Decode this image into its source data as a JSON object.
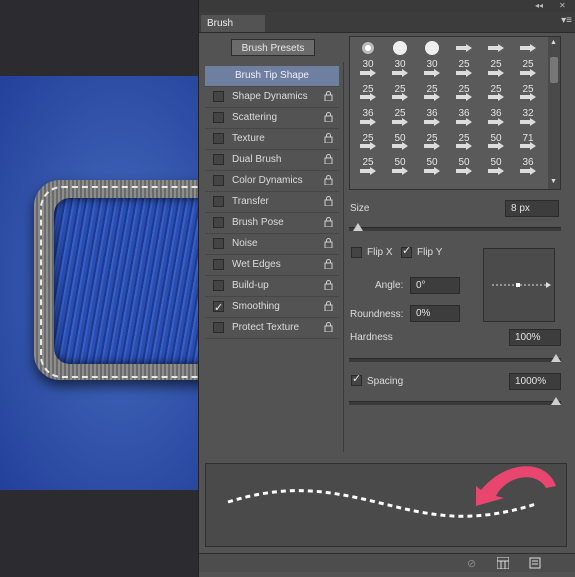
{
  "panel": {
    "tab_label": "Brush",
    "menu_icon": "panel-menu-icon",
    "collapse_icon": "double-chevron-icon",
    "close_icon": "close-icon"
  },
  "presets_button": "Brush Presets",
  "settings": [
    {
      "label": "Brush Tip Shape",
      "checkbox": false,
      "checked": false,
      "lock": false,
      "selected": true
    },
    {
      "label": "Shape Dynamics",
      "checkbox": true,
      "checked": false,
      "lock": true,
      "selected": false
    },
    {
      "label": "Scattering",
      "checkbox": true,
      "checked": false,
      "lock": true,
      "selected": false
    },
    {
      "label": "Texture",
      "checkbox": true,
      "checked": false,
      "lock": true,
      "selected": false
    },
    {
      "label": "Dual Brush",
      "checkbox": true,
      "checked": false,
      "lock": true,
      "selected": false
    },
    {
      "label": "Color Dynamics",
      "checkbox": true,
      "checked": false,
      "lock": true,
      "selected": false
    },
    {
      "label": "Transfer",
      "checkbox": true,
      "checked": false,
      "lock": true,
      "selected": false
    },
    {
      "label": "Brush Pose",
      "checkbox": true,
      "checked": false,
      "lock": true,
      "selected": false
    },
    {
      "label": "Noise",
      "checkbox": true,
      "checked": false,
      "lock": true,
      "selected": false
    },
    {
      "label": "Wet Edges",
      "checkbox": true,
      "checked": false,
      "lock": true,
      "selected": false
    },
    {
      "label": "Build-up",
      "checkbox": true,
      "checked": false,
      "lock": true,
      "selected": false
    },
    {
      "label": "Smoothing",
      "checkbox": true,
      "checked": true,
      "lock": true,
      "selected": false
    },
    {
      "label": "Protect Texture",
      "checkbox": true,
      "checked": false,
      "lock": true,
      "selected": false
    }
  ],
  "brush_tips": {
    "rows": [
      [
        "30",
        "30",
        "30",
        "25",
        "25",
        "25"
      ],
      [
        "25",
        "25",
        "25",
        "25",
        "25",
        "25"
      ],
      [
        "36",
        "25",
        "36",
        "36",
        "36",
        "32"
      ],
      [
        "25",
        "50",
        "25",
        "25",
        "50",
        "71"
      ],
      [
        "25",
        "50",
        "50",
        "50",
        "50",
        "36"
      ],
      [
        "",
        "",
        "",
        "",
        "",
        ""
      ]
    ],
    "glyphs": [
      [
        "soft-round",
        "hard-round",
        "hard-round",
        "arrow-brush",
        "arrow-brush",
        "arrow-brush"
      ],
      [
        "arrow-brush",
        "arrow-brush",
        "arrow-brush",
        "arrow-brush",
        "arrow-brush",
        "arrow-brush"
      ],
      [
        "arrow-brush",
        "arrow-brush",
        "arrow-brush",
        "arrow-brush",
        "arrow-brush",
        "arrow-brush"
      ],
      [
        "arrow-brush",
        "arrow-brush",
        "arrow-brush",
        "arrow-brush",
        "arrow-brush",
        "arrow-brush"
      ],
      [
        "arrow-brush",
        "arrow-brush",
        "arrow-brush",
        "arrow-brush",
        "arrow-brush",
        "arrow-brush"
      ],
      [
        "arrow-brush",
        "arrow-brush",
        "arrow-brush",
        "arrow-brush",
        "arrow-brush",
        "arrow-brush"
      ]
    ]
  },
  "size": {
    "label": "Size",
    "value": "8 px"
  },
  "flip_x": {
    "label": "Flip X",
    "checked": false
  },
  "flip_y": {
    "label": "Flip Y",
    "checked": true
  },
  "angle": {
    "label": "Angle:",
    "value": "0°"
  },
  "roundness": {
    "label": "Roundness:",
    "value": "0%"
  },
  "hardness": {
    "label": "Hardness",
    "value": "100%",
    "level": 1.0
  },
  "spacing": {
    "label": "Spacing",
    "value": "1000%",
    "checked": true,
    "level": 1.0
  },
  "size_level": 0.02,
  "colors": {
    "accent_arrow": "#e8466e",
    "selected_row": "#6f7f9f"
  }
}
